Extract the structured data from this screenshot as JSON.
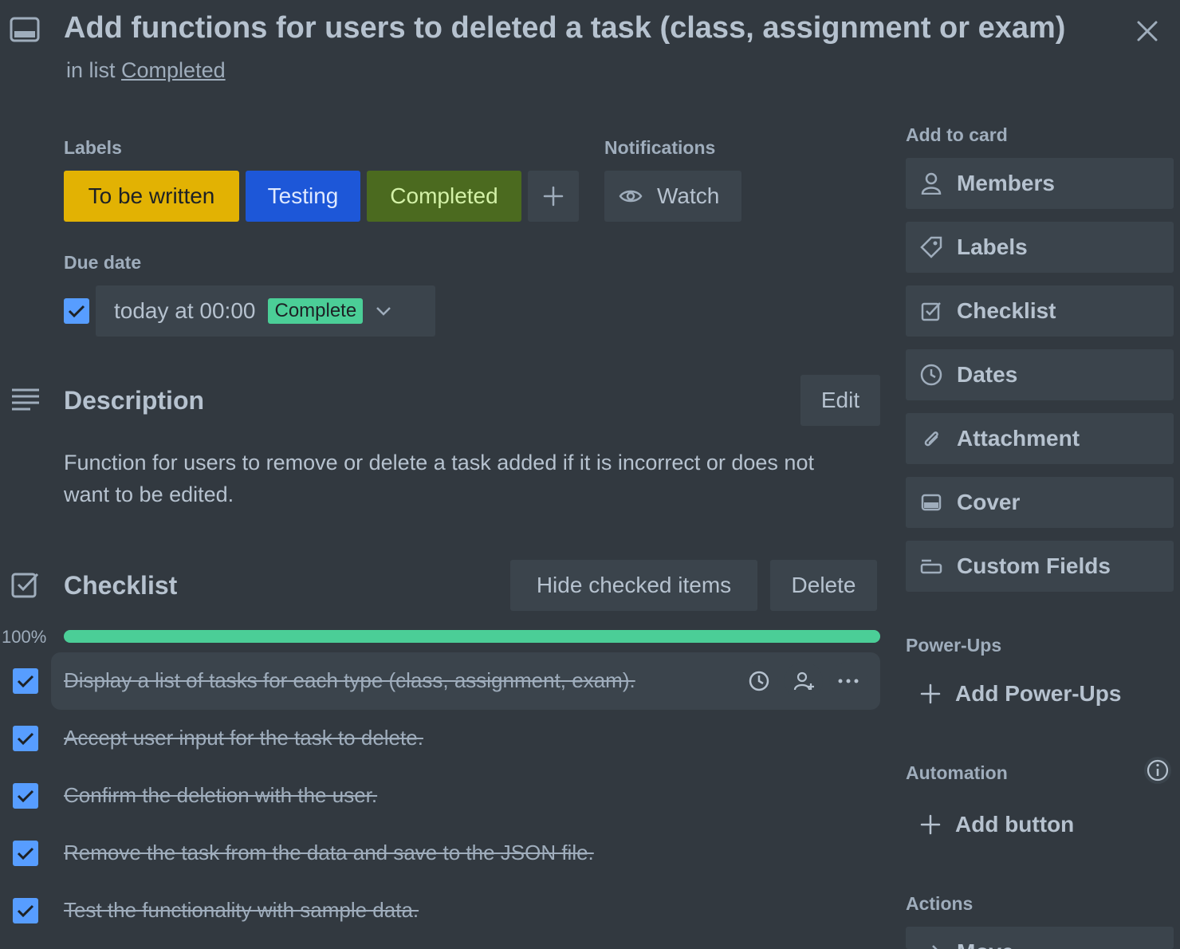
{
  "card": {
    "title": "Add functions for users to deleted a task (class, assignment or exam)",
    "list_prefix": "in list",
    "list_name": "Completed"
  },
  "labels": {
    "heading": "Labels",
    "items": [
      {
        "text": "To be written",
        "color": "#e2b203"
      },
      {
        "text": "Testing",
        "color": "#1d57d8"
      },
      {
        "text": "Completed",
        "color": "#4b6a1f"
      }
    ]
  },
  "notifications": {
    "heading": "Notifications",
    "watch_label": "Watch"
  },
  "due_date": {
    "heading": "Due date",
    "value": "today at 00:00",
    "status": "Complete",
    "checked": true
  },
  "description": {
    "heading": "Description",
    "edit_label": "Edit",
    "text_line1": "Function for users to remove or delete a task added if it is incorrect or does not",
    "text_line2": "want to be edited."
  },
  "checklist": {
    "heading": "Checklist",
    "hide_label": "Hide checked items",
    "delete_label": "Delete",
    "progress_text": "100%",
    "progress": 1.0,
    "items": [
      {
        "text": "Display a list of tasks for each type (class, assignment, exam).",
        "checked": true
      },
      {
        "text": "Accept user input for the task to delete.",
        "checked": true
      },
      {
        "text": "Confirm the deletion with the user.",
        "checked": true
      },
      {
        "text": "Remove the task from the data and save to the JSON file.",
        "checked": true
      },
      {
        "text": "Test the functionality with sample data.",
        "checked": true
      }
    ]
  },
  "sidebar": {
    "add_to_card_heading": "Add to card",
    "buttons": [
      {
        "label": "Members",
        "icon": "person-icon"
      },
      {
        "label": "Labels",
        "icon": "tag-icon"
      },
      {
        "label": "Checklist",
        "icon": "checkbox-icon"
      },
      {
        "label": "Dates",
        "icon": "clock-icon"
      },
      {
        "label": "Attachment",
        "icon": "paperclip-icon"
      },
      {
        "label": "Cover",
        "icon": "cover-icon"
      },
      {
        "label": "Custom Fields",
        "icon": "custom-fields-icon"
      }
    ],
    "powerups_heading": "Power-Ups",
    "add_powerups_label": "Add Power-Ups",
    "automation_heading": "Automation",
    "add_button_label": "Add button",
    "actions_heading": "Actions",
    "move_label": "Move"
  },
  "colors": {
    "background": "#323940",
    "accent_blue": "#579dff",
    "progress_green": "#4bce97",
    "complete_badge": "#4bce97"
  }
}
